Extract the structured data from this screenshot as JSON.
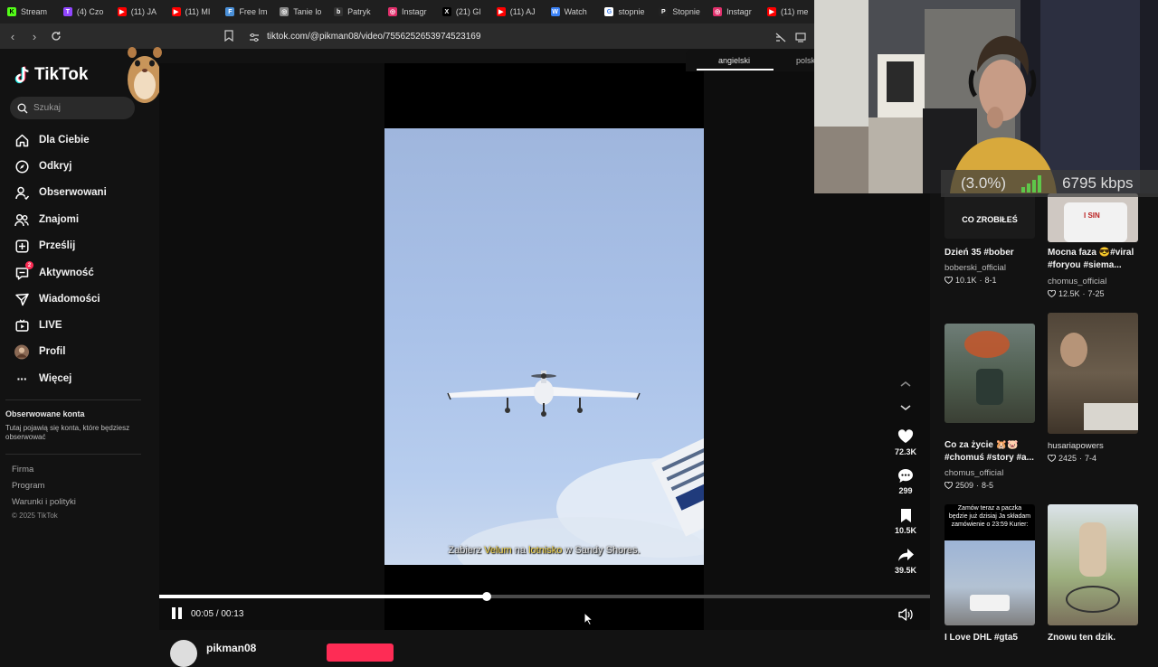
{
  "browser": {
    "tabs": [
      {
        "label": "Stream",
        "icon": "kick-icon",
        "color": "#53fc18"
      },
      {
        "label": "(4) Czo",
        "icon": "twitch-icon",
        "color": "#9146ff"
      },
      {
        "label": "(11) JA",
        "icon": "youtube-icon",
        "color": "#ff0000"
      },
      {
        "label": "(11) MI",
        "icon": "youtube-icon",
        "color": "#ff0000"
      },
      {
        "label": "Free Im",
        "icon": "image-icon",
        "color": "#4a90d9"
      },
      {
        "label": "Tanie lo",
        "icon": "compass-icon",
        "color": "#888888"
      },
      {
        "label": "Patryk",
        "icon": "b-icon",
        "color": "#333333"
      },
      {
        "label": "Instagr",
        "icon": "instagram-icon",
        "color": "#e1306c"
      },
      {
        "label": "(21) Gl",
        "icon": "x-icon",
        "color": "#000000"
      },
      {
        "label": "(11) AJ",
        "icon": "youtube-icon",
        "color": "#ff0000"
      },
      {
        "label": "Watch",
        "icon": "watch-icon",
        "color": "#3b82f6"
      },
      {
        "label": "stopnie",
        "icon": "google-icon",
        "color": "#ffffff"
      },
      {
        "label": "Stopnie",
        "icon": "p-icon",
        "color": "#222222"
      },
      {
        "label": "Instagr",
        "icon": "instagram-icon",
        "color": "#e1306c"
      },
      {
        "label": "(11) me",
        "icon": "youtube-icon",
        "color": "#ff0000"
      }
    ],
    "url": "tiktok.com/@pikman08/video/7556252653974523169"
  },
  "sidebar": {
    "logo": "TikTok",
    "search_placeholder": "Szukaj",
    "nav": [
      {
        "label": "Dla Ciebie",
        "icon": "home-icon"
      },
      {
        "label": "Odkryj",
        "icon": "compass-icon"
      },
      {
        "label": "Obserwowani",
        "icon": "following-icon"
      },
      {
        "label": "Znajomi",
        "icon": "friends-icon"
      },
      {
        "label": "Prześlij",
        "icon": "upload-icon"
      },
      {
        "label": "Aktywność",
        "icon": "activity-icon",
        "badge": "2"
      },
      {
        "label": "Wiadomości",
        "icon": "messages-icon"
      },
      {
        "label": "LIVE",
        "icon": "live-icon"
      },
      {
        "label": "Profil",
        "icon": "profile-avatar"
      },
      {
        "label": "Więcej",
        "icon": "more-icon"
      }
    ],
    "followed_title": "Obserwowane konta",
    "followed_hint": "Tutaj pojawią się konta, które będziesz obserwować",
    "footer_links": [
      "Firma",
      "Program",
      "Warunki i polityki"
    ],
    "copyright": "© 2025 TikTok"
  },
  "player": {
    "subtitle_pre": "Zabierz ",
    "subtitle_highlight1": "Velum",
    "subtitle_mid": " na ",
    "subtitle_highlight2": "lotnisko",
    "subtitle_post": " w Sandy Shores.",
    "time": "00:05 / 00:13",
    "progress": 0.4245,
    "author": "pikman08"
  },
  "language": {
    "active": "angielski",
    "other": "polsk"
  },
  "actions": {
    "likes": "72.3K",
    "comments": "299",
    "saves": "10.5K",
    "shares": "39.5K"
  },
  "recommendations": [
    {
      "thumb_text": "CO ZROBIŁEŚ",
      "title": "Dzień 35 #bober",
      "author": "boberski_official",
      "likes": "10.1K",
      "date": "8-1"
    },
    {
      "thumb_text": "I SIN",
      "title": "Mocna faza 😎#viral #foryou #siema...",
      "author": "chomus_official",
      "likes": "12.5K",
      "date": "7-25"
    },
    {
      "thumb_text": "",
      "title": "Co za życie 🐹🐷 #chomuś #story #a...",
      "author": "chomus_official",
      "likes": "2509",
      "date": "8-5"
    },
    {
      "thumb_text": "",
      "title": "",
      "author": "husariapowers",
      "likes": "2425",
      "date": "7-4"
    },
    {
      "thumb_text": "Zamów teraz a paczka będzie już dzisiaj Ja składam zamówienie o 23:59 Kurier:",
      "title": "I Love DHL #gta5",
      "author": "",
      "likes": "",
      "date": ""
    },
    {
      "thumb_text": "",
      "title": "Znowu ten dzik.",
      "author": "",
      "likes": "",
      "date": ""
    }
  ],
  "stream": {
    "stats": "(3.0%)",
    "bitrate": "6795 kbps"
  },
  "colors": {
    "accent": "#fe2c55",
    "bg": "#121212"
  }
}
